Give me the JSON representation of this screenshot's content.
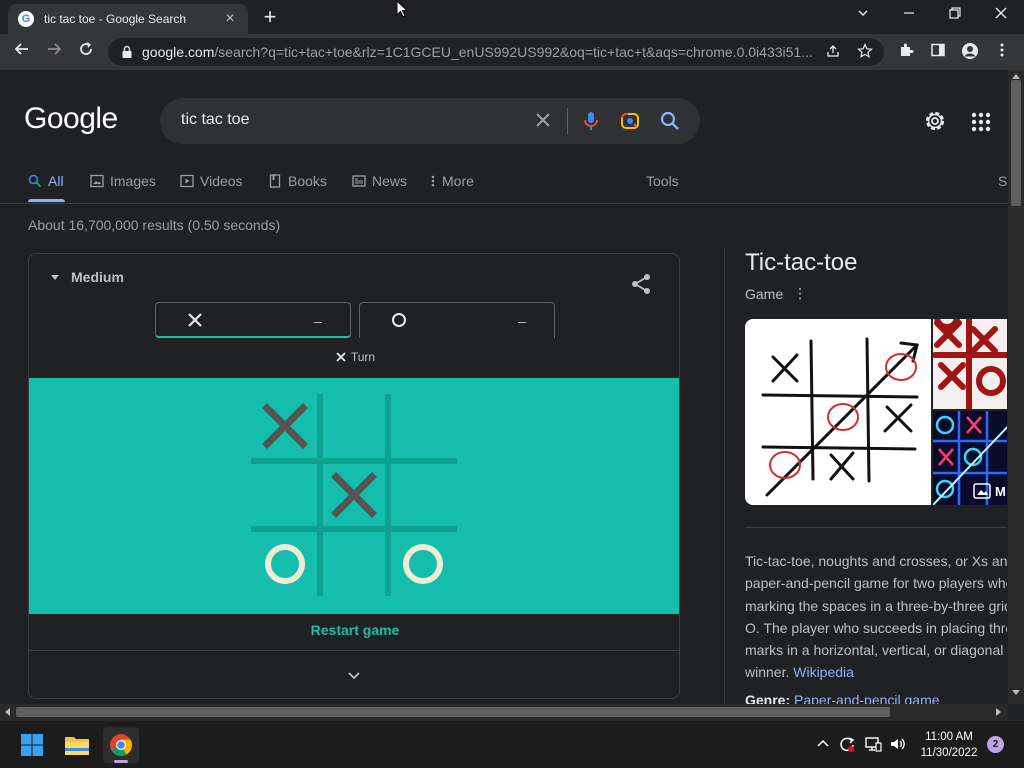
{
  "browser": {
    "tab_title": "tic tac toe - Google Search",
    "new_tab": "+",
    "url_host": "google.com",
    "url_rest": "/search?q=tic+tac+toe&rlz=1C1GCEU_enUS992US992&oq=tic+tac+t&aqs=chrome.0.0i433i51..."
  },
  "google": {
    "logo": "Google",
    "query": "tic tac toe",
    "tabs": [
      {
        "label": "All",
        "icon": "search-icon"
      },
      {
        "label": "Images",
        "icon": "image-icon"
      },
      {
        "label": "Videos",
        "icon": "play-icon"
      },
      {
        "label": "Books",
        "icon": "book-icon"
      },
      {
        "label": "News",
        "icon": "news-icon"
      },
      {
        "label": "More",
        "icon": "more-vert-icon"
      }
    ],
    "tools": "Tools",
    "partial_tab": "S",
    "result_stats": "About 16,700,000 results (0.50 seconds)"
  },
  "game": {
    "difficulty": "Medium",
    "player_x_score": "–",
    "player_o_score": "–",
    "turn_label": "Turn",
    "board": [
      "X",
      "",
      "",
      "",
      "X",
      "",
      "O",
      "",
      "O"
    ],
    "restart": "Restart game",
    "colors": {
      "board_bg": "#14bdac",
      "grid": "#0da192",
      "x_mark": "#545454",
      "o_mark": "#f2ebd3"
    }
  },
  "knowledge_panel": {
    "title": "Tic-tac-toe",
    "subtitle": "Game",
    "more_images_label": "M",
    "description_lines": [
      "Tic-tac-toe, noughts and crosses, or Xs and Os is a",
      "paper-and-pencil game for two players who take turns",
      "marking the spaces in a three-by-three grid with X or",
      "O. The player who succeeds in placing three of their",
      "marks in a horizontal, vertical, or diagonal row is the",
      "winner."
    ],
    "source_link": "Wikipedia",
    "genre_label": "Genre:",
    "genre_value": "Paper-and-pencil game"
  },
  "taskbar": {
    "time": "11:00 AM",
    "date": "11/30/2022",
    "notification_count": "2"
  }
}
